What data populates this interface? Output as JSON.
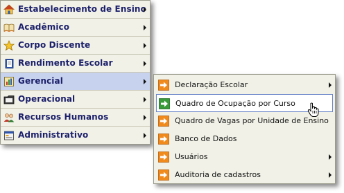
{
  "main_menu": {
    "items": [
      {
        "label": "Estabelecimento de Ensino",
        "icon": "home-icon"
      },
      {
        "label": "Acadêmico",
        "icon": "book-icon"
      },
      {
        "label": "Corpo Discente",
        "icon": "star-icon"
      },
      {
        "label": "Rendimento Escolar",
        "icon": "notebook-icon"
      },
      {
        "label": "Gerencial",
        "icon": "chart-icon"
      },
      {
        "label": "Operacional",
        "icon": "folder-icon"
      },
      {
        "label": "Recursos Humanos",
        "icon": "users-icon"
      },
      {
        "label": "Administrativo",
        "icon": "window-icon"
      }
    ],
    "active_item": "Gerencial"
  },
  "sub_menu": {
    "items": [
      {
        "label": "Declaração Escolar",
        "icon": "orange-arrow-icon",
        "has_submenu": true
      },
      {
        "label": "Quadro de Ocupação por Curso",
        "icon": "green-arrow-icon",
        "has_submenu": false
      },
      {
        "label": "Quadro de Vagas por Unidade de Ensino",
        "icon": "orange-arrow-icon",
        "has_submenu": false
      },
      {
        "label": "Banco de Dados",
        "icon": "orange-arrow-icon",
        "has_submenu": false
      },
      {
        "label": "Usuários",
        "icon": "orange-arrow-icon",
        "has_submenu": true
      },
      {
        "label": "Auditoria de cadastros",
        "icon": "orange-arrow-icon",
        "has_submenu": true
      }
    ],
    "active_item": "Quadro de Ocupação por Curso"
  },
  "colors": {
    "menu_bg": "#f1f1e7",
    "main_label": "#1b1f6a",
    "active_main_bg": "#c7d3ee",
    "active_sub_border": "#6b86c9"
  }
}
